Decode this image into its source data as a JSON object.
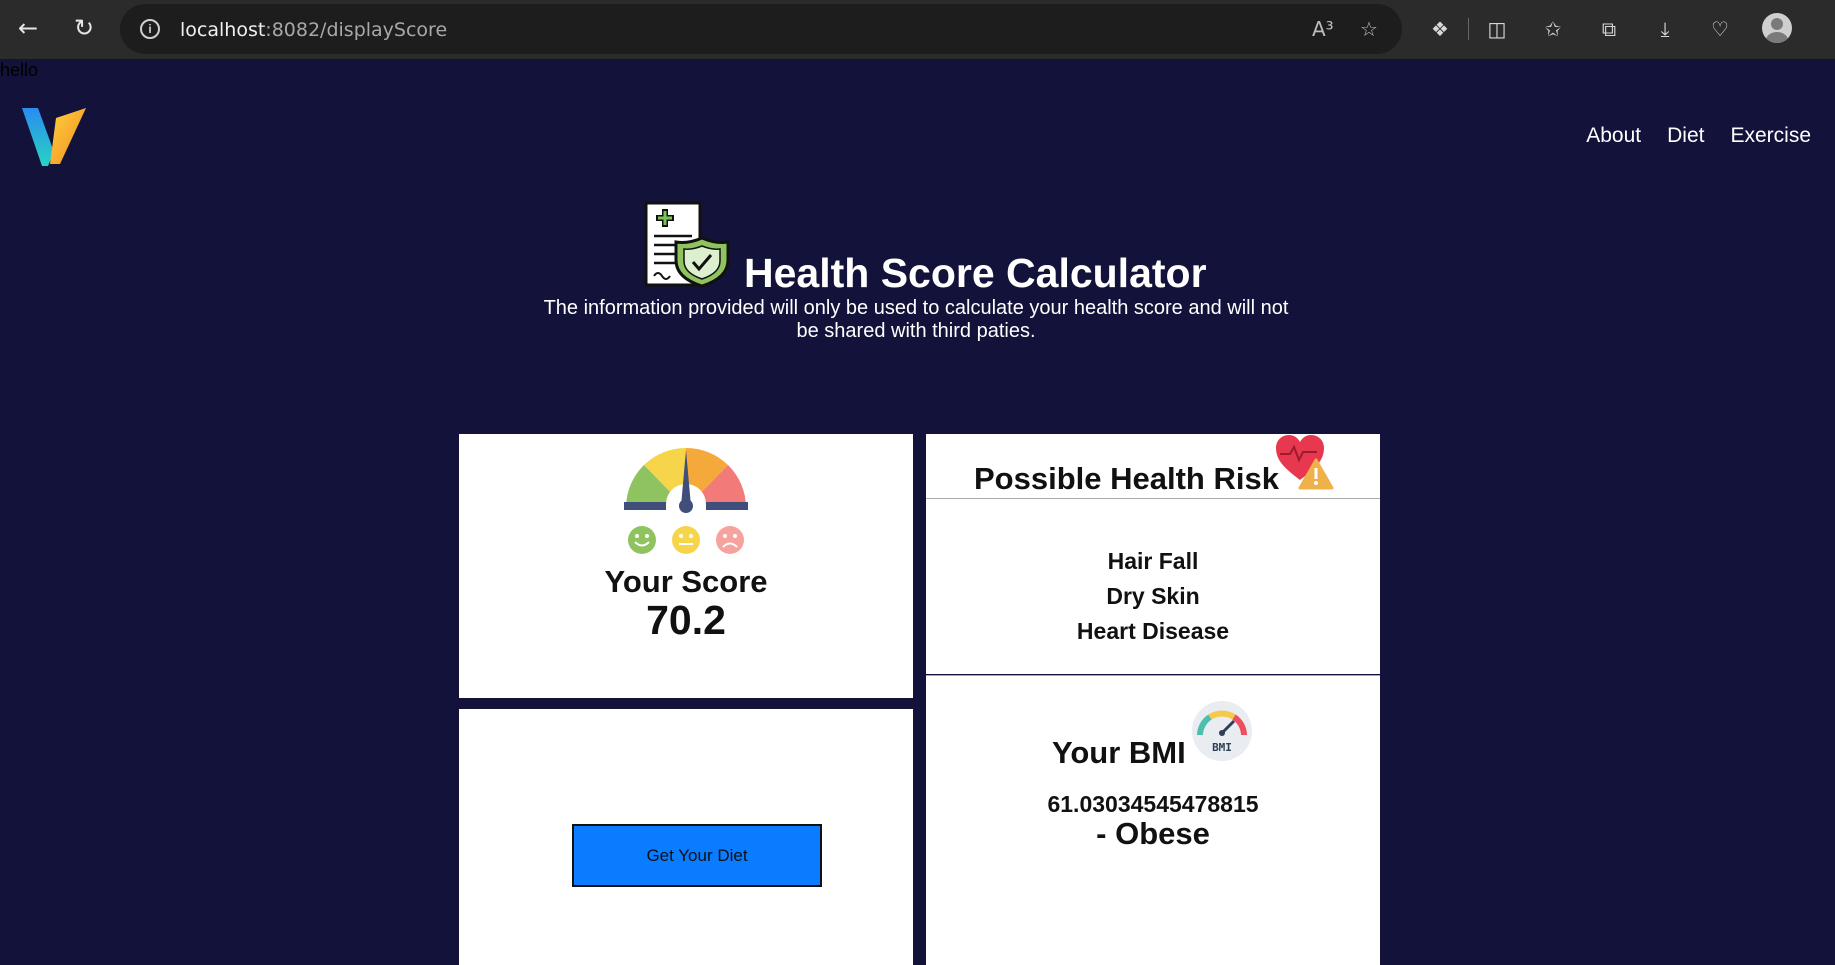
{
  "browser": {
    "url_host": "localhost",
    "url_path": ":8082/displayScore",
    "icons": [
      "back-icon",
      "refresh-icon",
      "info-icon",
      "read-aloud-icon",
      "favorite-star-icon",
      "extensions-icon",
      "split-screen-icon",
      "favorites-icon",
      "collections-icon",
      "downloads-icon",
      "health-icon",
      "profile-icon"
    ],
    "read_aloud_glyph": "A³"
  },
  "page": {
    "debug_text": "hello",
    "nav": [
      "About",
      "Diet",
      "Exercise"
    ],
    "title": "Health Score Calculator",
    "subtitle": "The information provided will only be used to calculate your health score and will not be shared with third paties."
  },
  "score": {
    "label": "Your Score",
    "value": "70.2"
  },
  "risk": {
    "title": "Possible Health Risk",
    "items": [
      "Hair Fall",
      "Dry Skin",
      "Heart Disease"
    ]
  },
  "bmi": {
    "label": "Your BMI",
    "icon_text": "BMI",
    "value": "61.03034545478815",
    "category": "- Obese"
  },
  "diet": {
    "button_label": "Get Your Diet"
  },
  "colors": {
    "page_bg": "#12123a",
    "button_bg": "#0a7cff",
    "gauge_green": "#8fc35f",
    "gauge_yellow": "#f6d54a",
    "gauge_orange": "#f6a93b",
    "gauge_red": "#f27a78"
  }
}
